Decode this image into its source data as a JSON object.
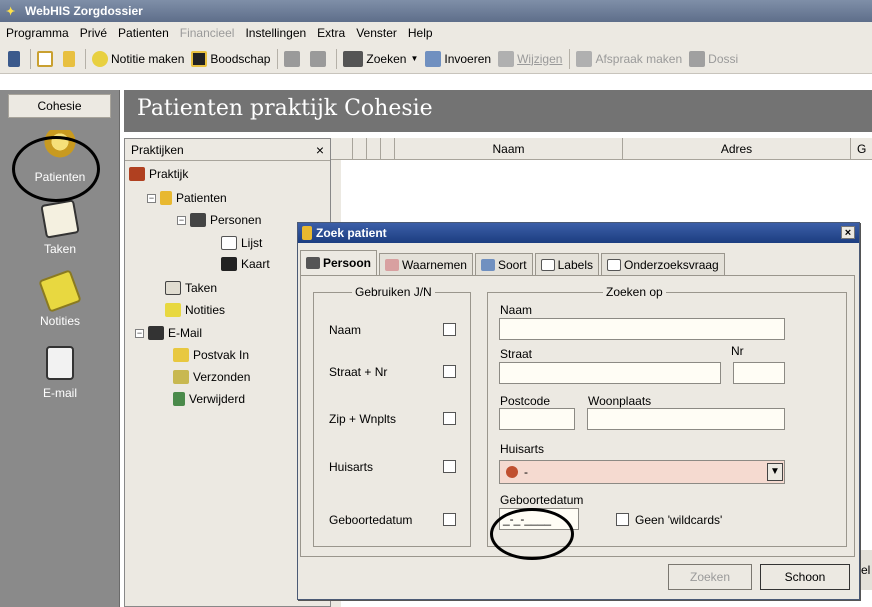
{
  "window": {
    "title": "WebHIS Zorgdossier"
  },
  "menu": [
    "Programma",
    "Privé",
    "Patienten",
    "Financieel",
    "Instellingen",
    "Extra",
    "Venster",
    "Help"
  ],
  "toolbar": {
    "notitie": "Notitie maken",
    "boodschap": "Boodschap",
    "zoeken": "Zoeken",
    "invoeren": "Invoeren",
    "wijzigen": "Wijzigen",
    "afspraak": "Afspraak maken",
    "dossier": "Dossi"
  },
  "sidebar": {
    "header": "Cohesie",
    "items": [
      {
        "label": "Patienten",
        "icon": "patient-icon"
      },
      {
        "label": "Taken",
        "icon": "tasks-icon"
      },
      {
        "label": "Notities",
        "icon": "notes-icon"
      },
      {
        "label": "E-mail",
        "icon": "email-icon"
      }
    ]
  },
  "main": {
    "title": "Patienten praktijk Cohesie"
  },
  "tree": {
    "header": "Praktijken",
    "close": "×",
    "nodes": [
      "Praktijk",
      "Patienten",
      "Personen",
      "Lijst",
      "Kaart",
      "Taken",
      "Notities",
      "E-Mail",
      "Postvak In",
      "Verzonden",
      "Verwijderd"
    ]
  },
  "table": {
    "columns": [
      "Naam",
      "Adres",
      "G"
    ]
  },
  "dialog": {
    "title": "Zoek patient",
    "close": "×",
    "tabs": [
      "Persoon",
      "Waarnemen",
      "Soort",
      "Labels",
      "Onderzoeksvraag"
    ],
    "use_group": {
      "legend": "Gebruiken J/N",
      "rows": [
        "Naam",
        "Straat + Nr",
        "Zip + Wnplts",
        "Huisarts",
        "Geboortedatum"
      ]
    },
    "search_group": {
      "legend": "Zoeken op",
      "naam": "Naam",
      "straat": "Straat",
      "nr": "Nr",
      "postcode": "Postcode",
      "woonplaats": "Woonplaats",
      "huisarts": "Huisarts",
      "huisarts_value": "-",
      "geboortedatum": "Geboortedatum",
      "geboortedatum_value": "_-_-____",
      "wildcards": "Geen 'wildcards'"
    },
    "buttons": {
      "zoeken": "Zoeken",
      "schoon": "Schoon"
    },
    "behind_partial": "el"
  }
}
